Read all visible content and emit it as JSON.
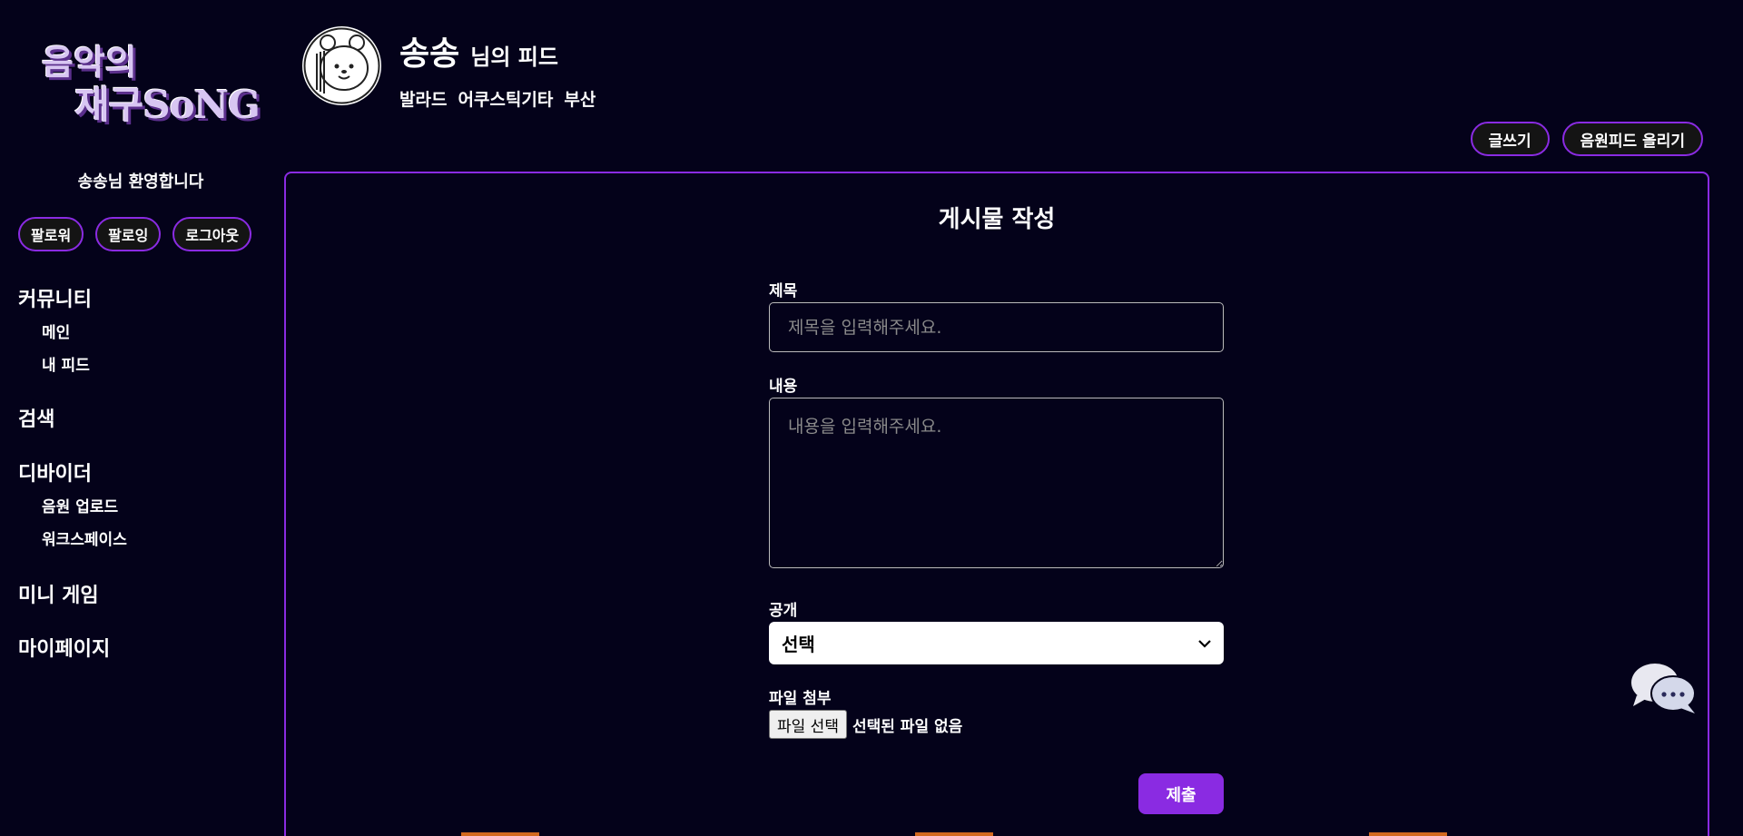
{
  "logo": {
    "line1": "음악의",
    "line2": "재구SoNG"
  },
  "profile": {
    "name": "송송",
    "feed_suffix": "님의 피드",
    "tags": [
      "발라드",
      "어쿠스틱기타",
      "부산"
    ]
  },
  "top_actions": {
    "write_label": "글쓰기",
    "upload_feed_label": "음원피드 올리기"
  },
  "sidebar": {
    "welcome": "송송님 환영합니다",
    "buttons": {
      "follower": "팔로워",
      "following": "팔로잉",
      "logout": "로그아웃"
    },
    "nav": {
      "community": "커뮤니티",
      "main": "메인",
      "my_feed": "내 피드",
      "search": "검색",
      "divider": "디바이더",
      "audio_upload": "음원 업로드",
      "workspace": "워크스페이스",
      "mini_game": "미니 게임",
      "mypage": "마이페이지"
    }
  },
  "form": {
    "title": "게시물 작성",
    "subject_label": "제목",
    "subject_placeholder": "제목을 입력해주세요.",
    "content_label": "내용",
    "content_placeholder": "내용을 입력해주세요.",
    "visibility_label": "공개",
    "visibility_selected": "선택",
    "file_label": "파일 첨부",
    "file_button": "파일 선택",
    "file_status": "선택된 파일 없음",
    "submit": "제출"
  },
  "colors": {
    "background": "#04021a",
    "accent": "#8a2be2"
  }
}
